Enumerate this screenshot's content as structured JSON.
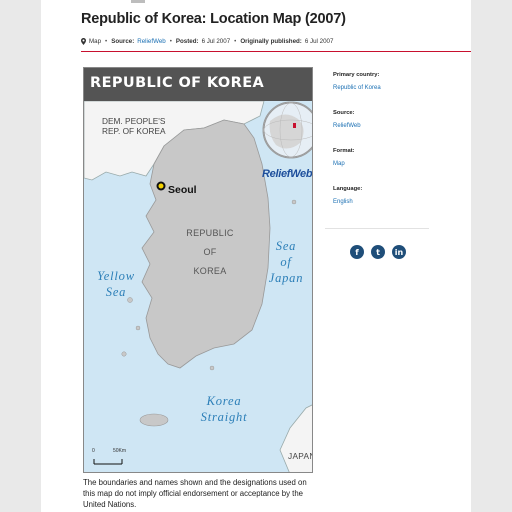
{
  "page": {
    "title": "Republic of Korea: Location Map (2007)"
  },
  "meta": {
    "type_label": "Map",
    "source_label": "Source:",
    "source_value": "ReliefWeb",
    "posted_label": "Posted:",
    "posted_value": "6 Jul 2007",
    "published_label": "Originally published:",
    "published_value": "6 Jul 2007",
    "separator": "•"
  },
  "map": {
    "header_title": "REPUBLIC OF KOREA",
    "dprk_line1": "DEM. PEOPLE'S",
    "dprk_line2": "REP. OF KOREA",
    "capital": "Seoul",
    "rok_line1": "REPUBLIC",
    "rok_line2": "OF",
    "rok_line3": "KOREA",
    "yellow_sea_line1": "Yellow",
    "yellow_sea_line2": "Sea",
    "sea_of_japan_line1": "Sea",
    "sea_of_japan_line2": "of",
    "sea_of_japan_line3": "Japan",
    "strait_line1": "Korea",
    "strait_line2": "Straight",
    "japan": "JAPAN",
    "scale_zero": "0",
    "scale_km": "50Km",
    "logo_text": "ReliefWeb"
  },
  "caption": "The boundaries and names shown and the designations used on this map do not imply official endorsement or acceptance by the United Nations.",
  "sidebar": {
    "primary_country_label": "Primary country:",
    "primary_country_value": "Republic of Korea",
    "source_label": "Source:",
    "source_value": "ReliefWeb",
    "format_label": "Format:",
    "format_value": "Map",
    "language_label": "Language:",
    "language_value": "English"
  },
  "social": {
    "facebook_icon": "f",
    "twitter_icon": "t",
    "linkedin_icon": "in"
  },
  "colors": {
    "accent_rule": "#c8102e",
    "link": "#1a6fb3",
    "sea": "#cfe6f4",
    "land_rok": "#c8c8c8",
    "land_other": "#f4f4f4",
    "water_label": "#2c7fb8",
    "social_bg": "#1f4e79"
  }
}
